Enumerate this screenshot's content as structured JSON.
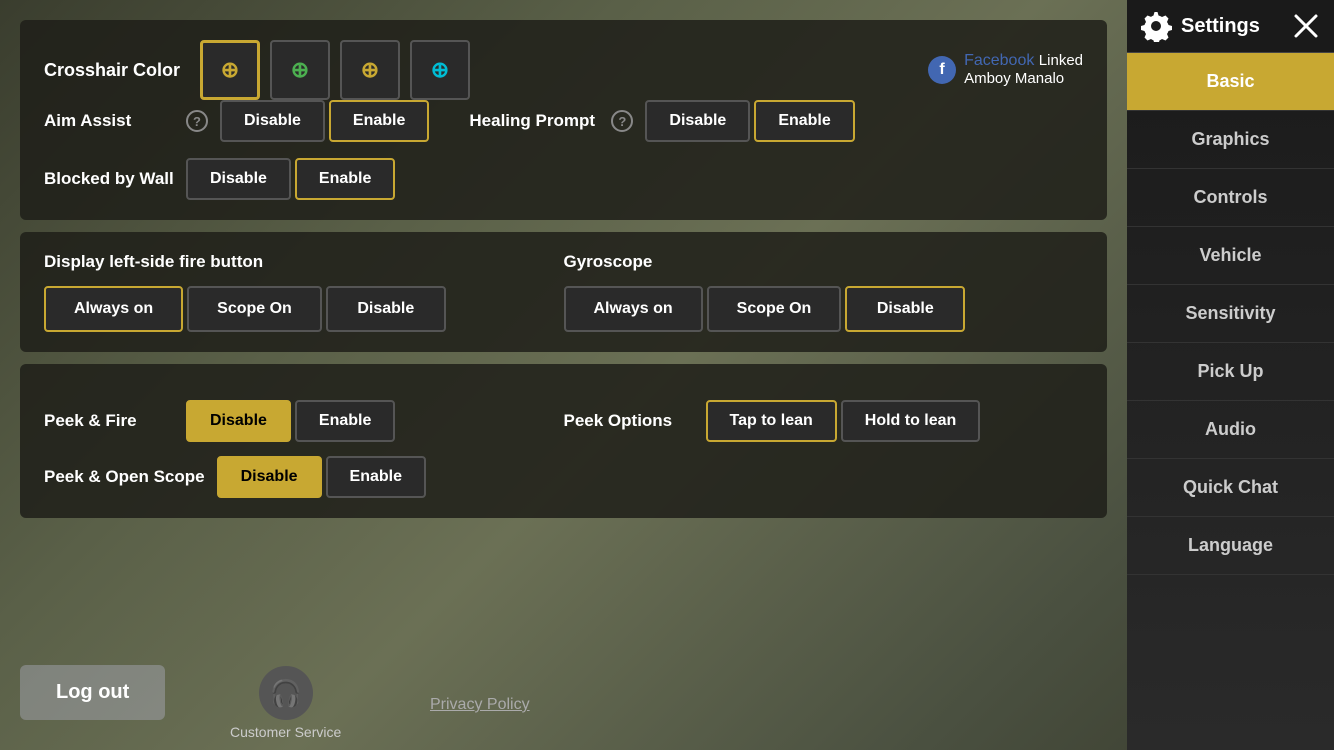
{
  "background": {
    "color": "#4a5040"
  },
  "sidebar": {
    "title": "Settings",
    "nav_items": [
      {
        "id": "basic",
        "label": "Basic",
        "active": true
      },
      {
        "id": "graphics",
        "label": "Graphics",
        "active": false
      },
      {
        "id": "controls",
        "label": "Controls",
        "active": false
      },
      {
        "id": "vehicle",
        "label": "Vehicle",
        "active": false
      },
      {
        "id": "sensitivity",
        "label": "Sensitivity",
        "active": false
      },
      {
        "id": "pickup",
        "label": "Pick Up",
        "active": false
      },
      {
        "id": "audio",
        "label": "Audio",
        "active": false
      },
      {
        "id": "quickchat",
        "label": "Quick Chat",
        "active": false
      },
      {
        "id": "language",
        "label": "Language",
        "active": false
      }
    ]
  },
  "crosshair": {
    "label": "Crosshair Color",
    "colors": [
      "gold",
      "green",
      "gold",
      "cyan"
    ],
    "selected": 0
  },
  "facebook": {
    "icon_label": "f",
    "link_text": "Facebook",
    "status": "Linked",
    "username": "Amboy Manalo"
  },
  "aim_assist": {
    "label": "Aim Assist",
    "disable_label": "Disable",
    "enable_label": "Enable",
    "selected": "enable"
  },
  "healing_prompt": {
    "label": "Healing Prompt",
    "disable_label": "Disable",
    "enable_label": "Enable",
    "selected": "enable"
  },
  "blocked_by_wall": {
    "label": "Blocked by Wall",
    "disable_label": "Disable",
    "enable_label": "Enable",
    "selected": "enable"
  },
  "display_fire_button": {
    "label": "Display left-side fire button",
    "options": [
      "Always on",
      "Scope On",
      "Disable"
    ],
    "selected": "Always on"
  },
  "gyroscope": {
    "label": "Gyroscope",
    "options": [
      "Always on",
      "Scope On",
      "Disable"
    ],
    "selected": "Disable"
  },
  "peek_fire": {
    "label": "Peek & Fire",
    "disable_label": "Disable",
    "enable_label": "Enable",
    "selected": "disable"
  },
  "peek_options": {
    "label": "Peek Options",
    "tap_label": "Tap to lean",
    "hold_label": "Hold to lean",
    "selected": "tap"
  },
  "peek_open_scope": {
    "label": "Peek & Open Scope",
    "disable_label": "Disable",
    "enable_label": "Enable",
    "selected": "disable"
  },
  "logout": {
    "label": "Log out"
  },
  "customer_service": {
    "label": "Customer Service",
    "icon": "🎧"
  },
  "privacy_policy": {
    "label": "Privacy Policy"
  },
  "close_button": "✕"
}
